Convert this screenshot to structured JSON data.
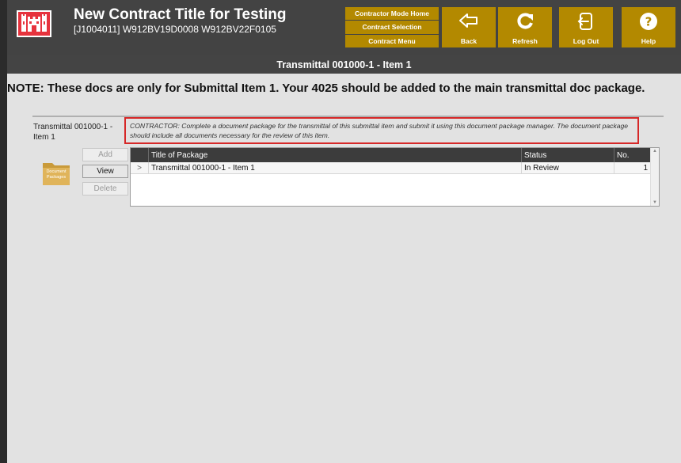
{
  "header": {
    "title": "New Contract Title for Testing",
    "subtitle": "[J1004011] W912BV19D0008  W912BV22F0105",
    "logo_icon": "castle-icon",
    "mode_buttons": [
      "Contractor Mode Home",
      "Contract Selection",
      "Contract Menu"
    ],
    "toolbar": [
      {
        "label": "Back",
        "icon": "back-arrow-icon"
      },
      {
        "label": "Refresh",
        "icon": "refresh-icon"
      },
      {
        "label": "Log Out",
        "icon": "logout-icon"
      },
      {
        "label": "Help",
        "icon": "help-icon"
      }
    ],
    "colors": {
      "header_bg": "#434343",
      "accent": "#b38900",
      "logo_red": "#e6333d"
    }
  },
  "section_title": "Transmittal 001000-1 - Item 1",
  "note": "NOTE: These docs are only for Submittal Item 1. Your 4025 should be added to the main transmittal doc package.",
  "item_label": "Transmittal 001000-1 - Item 1",
  "instruction": "CONTRACTOR: Complete a document package for the transmittal of this submittal item and submit it using this document package manager. The document package should include all documents necessary for the review of this item.",
  "folder_label": "Document Packages",
  "actions": {
    "add": "Add",
    "view": "View",
    "delete": "Delete"
  },
  "grid": {
    "columns": {
      "title": "Title of Package",
      "status": "Status",
      "no": "No."
    },
    "rows": [
      {
        "expander": ">",
        "title": "Transmittal 001000-1 - Item 1",
        "status": "In Review",
        "no": "1"
      }
    ]
  }
}
